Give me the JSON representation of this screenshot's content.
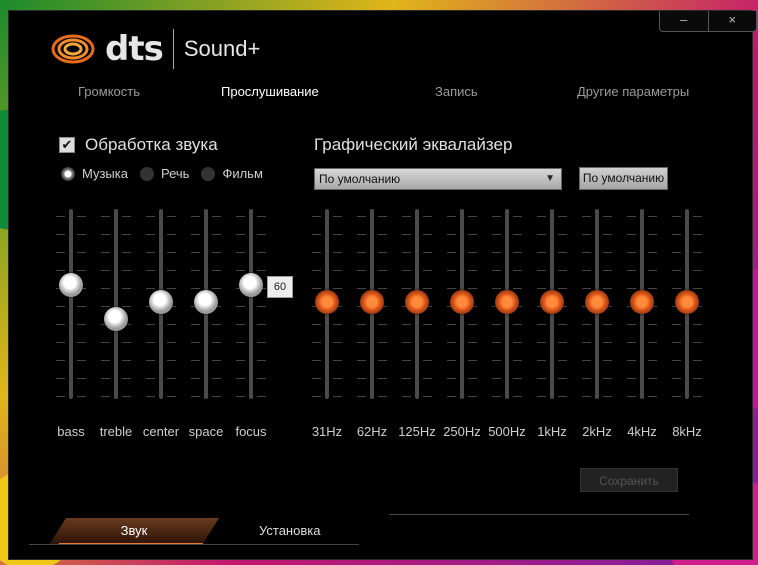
{
  "window": {
    "controls": [
      "–",
      "×"
    ]
  },
  "brand": {
    "logo": "dts",
    "product": "Sound+"
  },
  "tabs": [
    "Громкость",
    "Прослушивание",
    "Запись",
    "Другие параметры"
  ],
  "active_tab": "Прослушивание",
  "processing": {
    "label": "Обработка звука",
    "checked": true
  },
  "modes": [
    {
      "label": "Музыка",
      "selected": true
    },
    {
      "label": "Речь",
      "selected": false
    },
    {
      "label": "Фильм",
      "selected": false
    }
  ],
  "eq": {
    "title": "Графический эквалайзер",
    "preset": "По умолчанию",
    "default_button": "По умолчанию",
    "save_button": "Сохранить",
    "bands": [
      "31Hz",
      "62Hz",
      "125Hz",
      "250Hz",
      "500Hz",
      "1kHz",
      "2kHz",
      "4kHz",
      "8kHz"
    ]
  },
  "effects": {
    "labels": [
      "bass",
      "treble",
      "center",
      "space",
      "focus"
    ],
    "tooltip_value": "60"
  },
  "bottom_tabs": [
    "Звук",
    "Установка"
  ],
  "accent_color": "#e8641e"
}
